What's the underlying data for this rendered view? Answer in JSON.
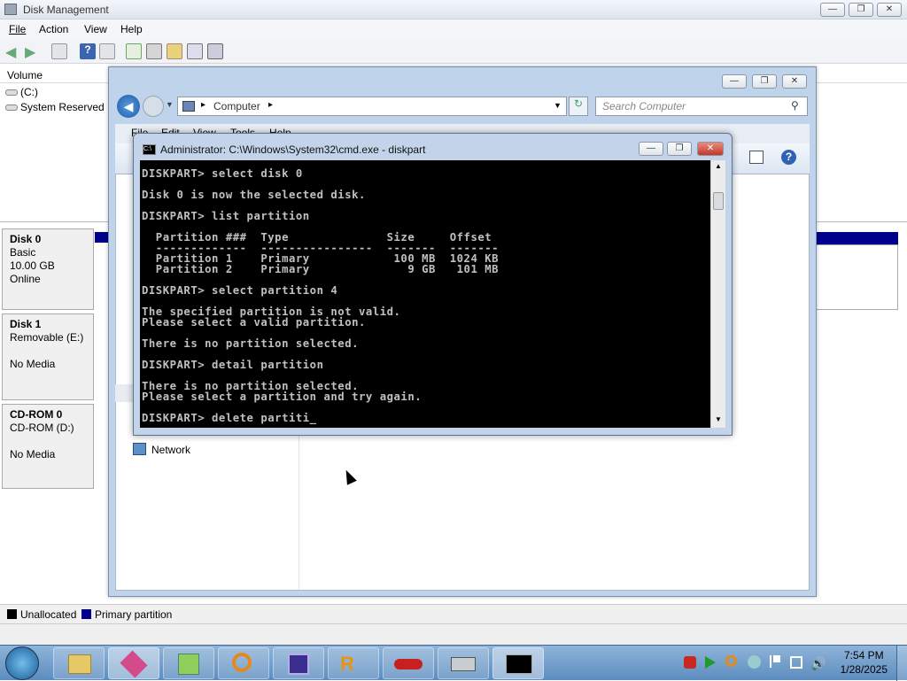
{
  "dm": {
    "title": "Disk Management",
    "menus": [
      "File",
      "Action",
      "View",
      "Help"
    ],
    "volume_header": "Volume",
    "volumes": [
      "(C:)",
      "System Reserved"
    ],
    "disks": [
      {
        "name": "Disk 0",
        "line1": "Basic",
        "line2": "10.00 GB",
        "line3": "Online"
      },
      {
        "name": "Disk 1",
        "line1": "Removable (E:)",
        "line2": "",
        "line3": "No Media"
      },
      {
        "name": "CD-ROM 0",
        "line1": "CD-ROM (D:)",
        "line2": "",
        "line3": "No Media"
      }
    ],
    "legend": [
      "Unallocated",
      "Primary partition"
    ],
    "legend_colors": {
      "unallocated": "#000000",
      "primary": "#00008b"
    }
  },
  "explorer": {
    "address_root": "Computer",
    "search_placeholder": "Search Computer",
    "menu": [
      "File",
      "Edit",
      "View",
      "Tools",
      "Help"
    ],
    "network_label": "Network"
  },
  "cmd": {
    "title": "Administrator: C:\\Windows\\System32\\cmd.exe - diskpart",
    "lines": [
      "DISKPART> select disk 0",
      "",
      "Disk 0 is now the selected disk.",
      "",
      "DISKPART> list partition",
      "",
      "  Partition ###  Type              Size     Offset",
      "  -------------  ----------------  -------  -------",
      "  Partition 1    Primary            100 MB  1024 KB",
      "  Partition 2    Primary              9 GB   101 MB",
      "",
      "DISKPART> select partition 4",
      "",
      "The specified partition is not valid.",
      "Please select a valid partition.",
      "",
      "There is no partition selected.",
      "",
      "DISKPART> detail partition",
      "",
      "There is no partition selected.",
      "Please select a partition and try again.",
      "",
      "DISKPART> delete partiti_"
    ]
  },
  "taskbar": {
    "time": "7:54 PM",
    "date": "1/28/2025",
    "apps": [
      "explorer",
      "virtualbox",
      "notepad-plus",
      "search-tool",
      "cpu-z",
      "resource-hacker",
      "chili",
      "disk-tool",
      "cmd"
    ]
  }
}
